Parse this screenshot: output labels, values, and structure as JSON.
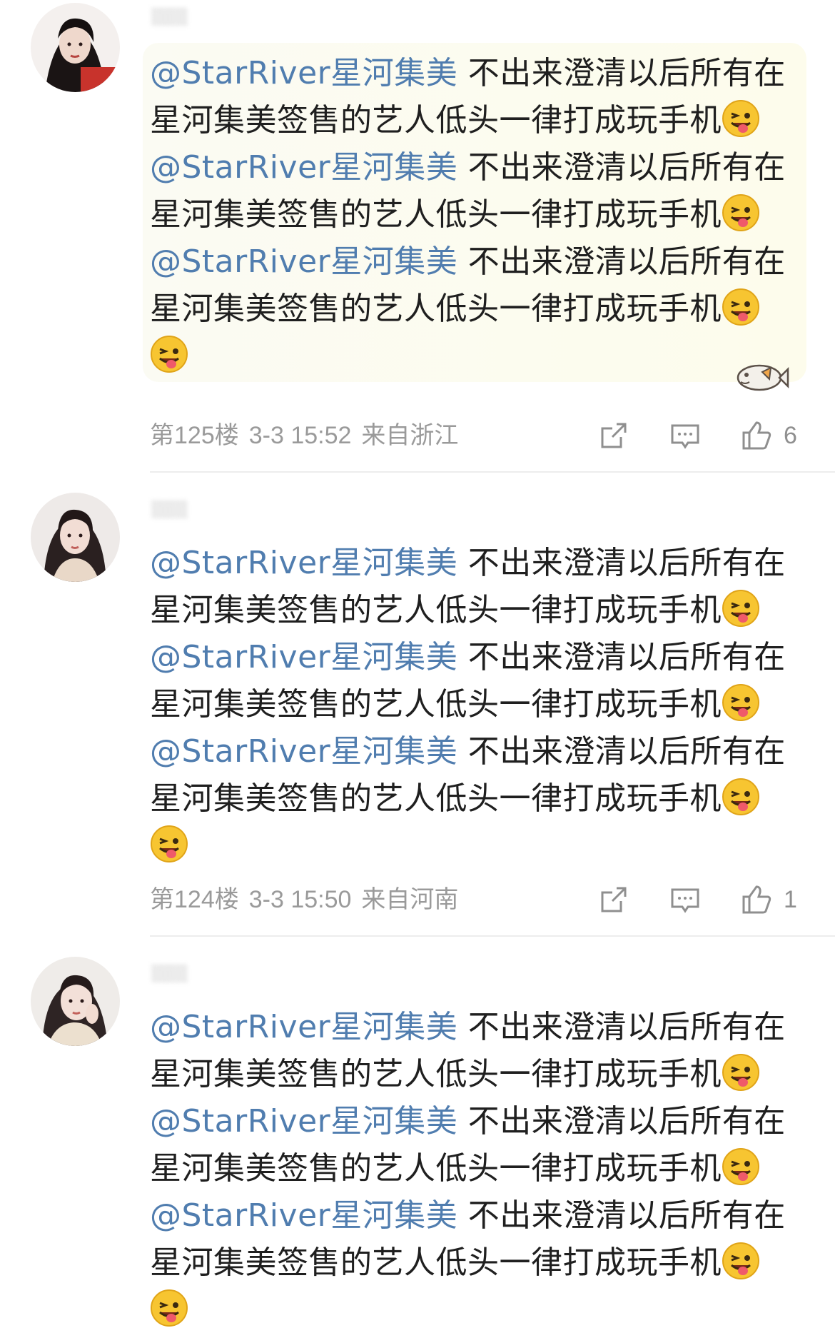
{
  "comments": [
    {
      "lines": [
        {
          "mention": "@StarRiver星河集美",
          "text": " 不出来澄清以后所有在"
        },
        {
          "mention": "",
          "text": "星河集美签售的艺人低头一律打成玩手机"
        },
        {
          "mention": "@StarRiver星河集美",
          "text": " 不出来澄清以后所有在"
        },
        {
          "mention": "",
          "text": "星河集美签售的艺人低头一律打成玩手机"
        },
        {
          "mention": "@StarRiver星河集美",
          "text": " 不出来澄清以后所有在"
        },
        {
          "mention": "",
          "text": "星河集美签售的艺人低头一律打成玩手机"
        }
      ],
      "floor": "第125楼",
      "time": "3-3 15:52",
      "location": "来自浙江",
      "likes": "6"
    },
    {
      "lines": [
        {
          "mention": "@StarRiver星河集美",
          "text": " 不出来澄清以后所有在"
        },
        {
          "mention": "",
          "text": "星河集美签售的艺人低头一律打成玩手机"
        },
        {
          "mention": "@StarRiver星河集美",
          "text": " 不出来澄清以后所有在"
        },
        {
          "mention": "",
          "text": "星河集美签售的艺人低头一律打成玩手机"
        },
        {
          "mention": "@StarRiver星河集美",
          "text": " 不出来澄清以后所有在"
        },
        {
          "mention": "",
          "text": "星河集美签售的艺人低头一律打成玩手机"
        }
      ],
      "floor": "第124楼",
      "time": "3-3 15:50",
      "location": "来自河南",
      "likes": "1"
    },
    {
      "lines": [
        {
          "mention": "@StarRiver星河集美",
          "text": " 不出来澄清以后所有在"
        },
        {
          "mention": "",
          "text": "星河集美签售的艺人低头一律打成玩手机"
        },
        {
          "mention": "@StarRiver星河集美",
          "text": " 不出来澄清以后所有在"
        },
        {
          "mention": "",
          "text": "星河集美签售的艺人低头一律打成玩手机"
        },
        {
          "mention": "@StarRiver星河集美",
          "text": " 不出来澄清以后所有在"
        },
        {
          "mention": "",
          "text": "星河集美签售的艺人低头一律打成玩手机"
        }
      ]
    }
  ],
  "icons": {
    "share": "share-icon",
    "comment": "comment-icon",
    "like": "thumbs-up-icon",
    "emoji": "tongue-emoji-icon",
    "decoration": "fish-icon"
  },
  "colors": {
    "mention": "#507daf",
    "text": "#1f1f1f",
    "meta": "#9a9a9a",
    "bubble": "#fbfbf1"
  }
}
